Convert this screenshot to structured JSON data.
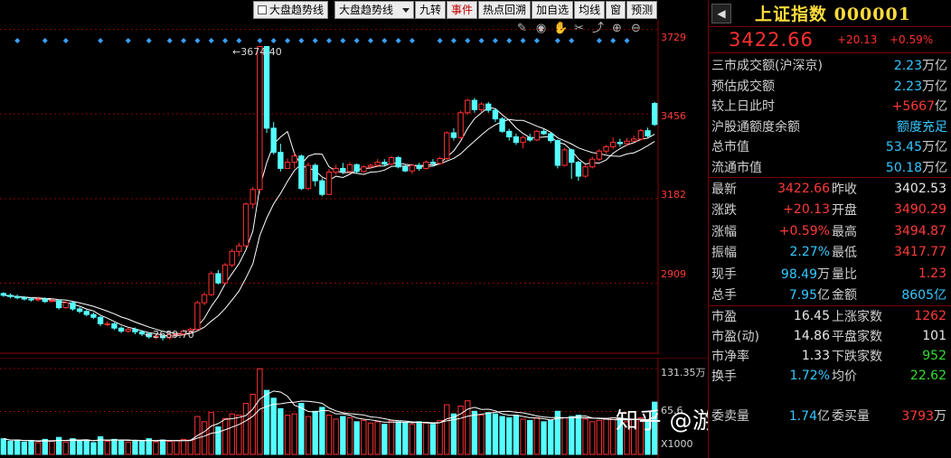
{
  "toolbar": {
    "trend_checkbox_label": "大盘趋势线",
    "trend_dropdown_value": "大盘趋势线",
    "buttons": [
      "九转",
      "事件",
      "热点回溯",
      "加自选",
      "均线",
      "窗",
      "预测"
    ]
  },
  "tools": {
    "icons": [
      "pencil-icon",
      "eye-icon",
      "hand-icon",
      "scissors-icon",
      "share-icon",
      "zoom-in-icon",
      "zoom-out-icon"
    ]
  },
  "price_axis": {
    "ticks": [
      "3729",
      "3456",
      "3182",
      "2909"
    ]
  },
  "volume_axis": {
    "top": "131.35万",
    "mid": "65.6",
    "unit": "X1000"
  },
  "annotations": {
    "high": "3674.40",
    "low": "2689.70"
  },
  "watermark": "知乎 @游资六一中路本尊",
  "panel": {
    "back_glyph": "◀",
    "title": "上证指数 000001",
    "price": "3422.66",
    "change": "+20.13",
    "change_pct": "+0.59%",
    "stats": [
      {
        "k": "三市成交额(沪深京)",
        "v": "2.23",
        "u": "万亿",
        "color": "blue"
      },
      {
        "k": "预估成交额",
        "v": "2.23",
        "u": "万亿",
        "color": "blue"
      },
      {
        "k": "较上日此时",
        "v": "+5667",
        "u": "亿",
        "color": "red"
      },
      {
        "k": "沪股通额度余额",
        "v": "额度充足",
        "u": "",
        "color": "blue"
      },
      {
        "k": "总市值",
        "v": "53.45",
        "u": "万亿",
        "color": "blue"
      },
      {
        "k": "流通市值",
        "v": "50.18",
        "u": "万亿",
        "color": "blue"
      }
    ],
    "quote_grid": [
      {
        "k1": "最新",
        "v1": "3422.66",
        "u1": "",
        "c1": "red",
        "k2": "昨收",
        "v2": "3402.53",
        "c2": "white"
      },
      {
        "k1": "涨跌",
        "v1": "+20.13",
        "u1": "",
        "c1": "red",
        "k2": "开盘",
        "v2": "3490.29",
        "c2": "red"
      },
      {
        "k1": "涨幅",
        "v1": "+0.59%",
        "u1": "",
        "c1": "red",
        "k2": "最高",
        "v2": "3494.87",
        "c2": "red"
      },
      {
        "k1": "振幅",
        "v1": "2.27%",
        "u1": "",
        "c1": "blue",
        "k2": "最低",
        "v2": "3417.77",
        "c2": "red"
      },
      {
        "k1": "现手",
        "v1": "98.49",
        "u1": "万",
        "c1": "blue",
        "k2": "量比",
        "v2": "1.23",
        "c2": "red"
      },
      {
        "k1": "总手",
        "v1": "7.95",
        "u1": "亿",
        "c1": "blue",
        "k2": "金额",
        "v2": "8605亿",
        "c2": "blue"
      }
    ],
    "market_grid": [
      {
        "k1": "市盈",
        "v1": "16.45",
        "u1": "",
        "c1": "white",
        "k2": "上涨家数",
        "v2": "1262",
        "c2": "red"
      },
      {
        "k1": "市盈(动)",
        "v1": "14.86",
        "u1": "",
        "c1": "white",
        "k2": "平盘家数",
        "v2": "101",
        "c2": "white"
      },
      {
        "k1": "市净率",
        "v1": "1.33",
        "u1": "",
        "c1": "white",
        "k2": "下跌家数",
        "v2": "952",
        "c2": "green"
      },
      {
        "k1": "换手",
        "v1": "1.72%",
        "u1": "",
        "c1": "blue",
        "k2": "均价",
        "v2": "22.62",
        "c2": "green"
      },
      {
        "k1": "",
        "v1": "",
        "u1": "",
        "c1": "white",
        "k2": "",
        "v2": "",
        "c2": "white"
      },
      {
        "k1": "委卖量",
        "v1": "1.74",
        "u1": "亿",
        "c1": "blue",
        "k2": "委买量",
        "v2": "3793",
        "u2": "万",
        "c2": "red"
      }
    ]
  },
  "colors": {
    "up": "#ff3232",
    "down": "#54ffff",
    "grid": "#8b0000",
    "ma": "#ffffff"
  },
  "chart_data": {
    "type": "candlestick",
    "price_range": [
      2680,
      3760
    ],
    "volume_range": [
      0,
      131.35
    ],
    "candles": [
      [
        2876,
        2870,
        2880,
        2865
      ],
      [
        2870,
        2866,
        2876,
        2860
      ],
      [
        2866,
        2862,
        2872,
        2857
      ],
      [
        2862,
        2858,
        2868,
        2853
      ],
      [
        2858,
        2856,
        2864,
        2850
      ],
      [
        2856,
        2858,
        2866,
        2850
      ],
      [
        2858,
        2850,
        2864,
        2845
      ],
      [
        2850,
        2853,
        2862,
        2848
      ],
      [
        2853,
        2830,
        2856,
        2824
      ],
      [
        2830,
        2846,
        2852,
        2826
      ],
      [
        2846,
        2826,
        2850,
        2820
      ],
      [
        2826,
        2818,
        2832,
        2812
      ],
      [
        2818,
        2808,
        2824,
        2802
      ],
      [
        2808,
        2799,
        2814,
        2794
      ],
      [
        2799,
        2778,
        2803,
        2770
      ],
      [
        2778,
        2778,
        2786,
        2770
      ],
      [
        2778,
        2764,
        2782,
        2758
      ],
      [
        2764,
        2754,
        2770,
        2748
      ],
      [
        2754,
        2760,
        2766,
        2748
      ],
      [
        2760,
        2752,
        2766,
        2744
      ],
      [
        2752,
        2745,
        2758,
        2738
      ],
      [
        2745,
        2736,
        2750,
        2730
      ],
      [
        2736,
        2738,
        2744,
        2728
      ],
      [
        2738,
        2733,
        2742,
        2724
      ],
      [
        2733,
        2742,
        2748,
        2726
      ],
      [
        2742,
        2745,
        2750,
        2736
      ],
      [
        2745,
        2755,
        2760,
        2738
      ],
      [
        2755,
        2760,
        2766,
        2746
      ],
      [
        2760,
        2846,
        2852,
        2756
      ],
      [
        2846,
        2872,
        2880,
        2838
      ],
      [
        2872,
        2940,
        2948,
        2868
      ],
      [
        2940,
        2910,
        2952,
        2905
      ],
      [
        2910,
        2968,
        2975,
        2906
      ],
      [
        2968,
        3012,
        3020,
        2960
      ],
      [
        3012,
        3030,
        3040,
        2996
      ],
      [
        3030,
        3165,
        3170,
        3025
      ],
      [
        3165,
        3212,
        3220,
        3150
      ],
      [
        3212,
        3674,
        3674,
        3200
      ],
      [
        3674,
        3410,
        3560,
        3395
      ],
      [
        3410,
        3332,
        3430,
        3325
      ],
      [
        3332,
        3280,
        3360,
        3270
      ],
      [
        3280,
        3300,
        3312,
        3278
      ],
      [
        3300,
        3320,
        3330,
        3280
      ],
      [
        3320,
        3215,
        3325,
        3210
      ],
      [
        3215,
        3290,
        3300,
        3210
      ],
      [
        3290,
        3240,
        3296,
        3222
      ],
      [
        3240,
        3196,
        3248,
        3190
      ],
      [
        3196,
        3268,
        3278,
        3194
      ],
      [
        3268,
        3280,
        3292,
        3260
      ],
      [
        3280,
        3270,
        3298,
        3262
      ],
      [
        3270,
        3292,
        3300,
        3264
      ],
      [
        3292,
        3270,
        3296,
        3262
      ],
      [
        3270,
        3285,
        3290,
        3265
      ],
      [
        3285,
        3290,
        3296,
        3278
      ],
      [
        3290,
        3300,
        3310,
        3284
      ],
      [
        3300,
        3294,
        3310,
        3288
      ],
      [
        3294,
        3315,
        3320,
        3290
      ],
      [
        3315,
        3285,
        3320,
        3280
      ],
      [
        3285,
        3272,
        3292,
        3268
      ],
      [
        3272,
        3290,
        3295,
        3262
      ],
      [
        3290,
        3280,
        3298,
        3272
      ],
      [
        3280,
        3300,
        3306,
        3276
      ],
      [
        3300,
        3296,
        3310,
        3286
      ],
      [
        3296,
        3312,
        3318,
        3292
      ],
      [
        3312,
        3395,
        3400,
        3308
      ],
      [
        3395,
        3380,
        3410,
        3370
      ],
      [
        3380,
        3460,
        3466,
        3376
      ],
      [
        3460,
        3500,
        3505,
        3454
      ],
      [
        3500,
        3470,
        3508,
        3460
      ],
      [
        3470,
        3488,
        3494,
        3462
      ],
      [
        3488,
        3468,
        3495,
        3460
      ],
      [
        3468,
        3440,
        3472,
        3430
      ],
      [
        3440,
        3400,
        3446,
        3395
      ],
      [
        3400,
        3382,
        3408,
        3370
      ],
      [
        3382,
        3364,
        3392,
        3356
      ],
      [
        3364,
        3380,
        3386,
        3345
      ],
      [
        3380,
        3372,
        3392,
        3366
      ],
      [
        3372,
        3400,
        3404,
        3368
      ],
      [
        3400,
        3392,
        3408,
        3388
      ],
      [
        3392,
        3370,
        3396,
        3362
      ],
      [
        3370,
        3290,
        3374,
        3280
      ],
      [
        3290,
        3340,
        3346,
        3286
      ],
      [
        3340,
        3300,
        3344,
        3246
      ],
      [
        3300,
        3255,
        3305,
        3240
      ],
      [
        3255,
        3285,
        3292,
        3250
      ],
      [
        3285,
        3310,
        3318,
        3280
      ],
      [
        3310,
        3336,
        3342,
        3304
      ],
      [
        3336,
        3350,
        3356,
        3328
      ],
      [
        3350,
        3364,
        3380,
        3342
      ],
      [
        3364,
        3360,
        3376,
        3350
      ],
      [
        3360,
        3368,
        3378,
        3352
      ],
      [
        3368,
        3375,
        3386,
        3366
      ],
      [
        3375,
        3402,
        3408,
        3370
      ],
      [
        3402,
        3385,
        3412,
        3380
      ],
      [
        3490,
        3422,
        3495,
        3417
      ]
    ],
    "volumes": [
      24,
      20,
      22,
      19,
      21,
      18,
      23,
      20,
      26,
      19,
      24,
      21,
      22,
      18,
      27,
      20,
      23,
      22,
      19,
      21,
      20,
      24,
      19,
      22,
      20,
      21,
      23,
      22,
      58,
      50,
      64,
      42,
      55,
      62,
      60,
      78,
      92,
      131,
      98,
      86,
      70,
      60,
      62,
      78,
      58,
      66,
      72,
      60,
      54,
      58,
      56,
      50,
      52,
      48,
      50,
      46,
      52,
      50,
      48,
      46,
      50,
      48,
      46,
      52,
      76,
      62,
      74,
      82,
      66,
      60,
      64,
      62,
      58,
      56,
      60,
      54,
      52,
      56,
      50,
      52,
      66,
      56,
      58,
      60,
      54,
      50,
      52,
      54,
      56,
      52,
      50,
      54,
      56,
      52,
      80
    ]
  }
}
